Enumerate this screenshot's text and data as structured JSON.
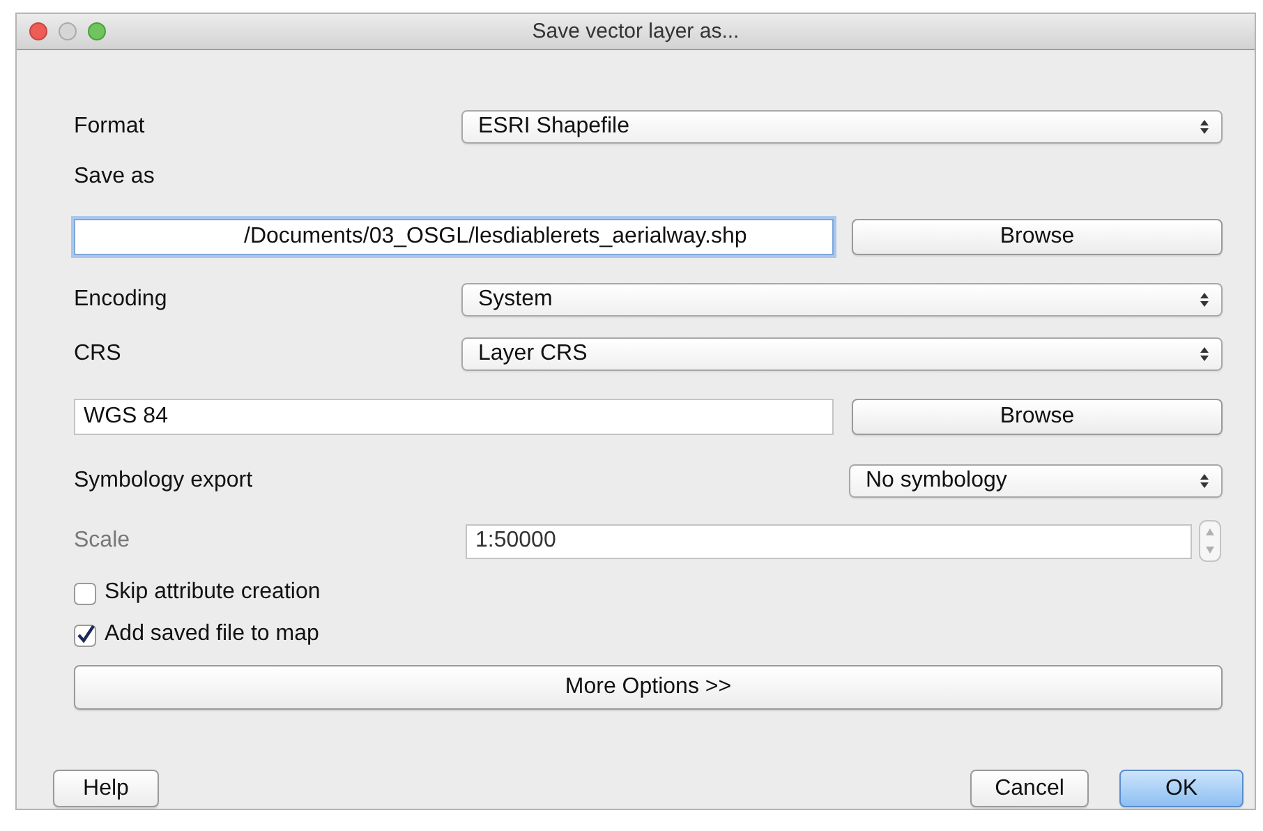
{
  "window": {
    "title": "Save vector layer as..."
  },
  "format": {
    "label": "Format",
    "value": "ESRI Shapefile"
  },
  "save_as": {
    "label": "Save as",
    "value": "/Documents/03_OSGL/lesdiablerets_aerialway.shp",
    "focused": true,
    "browse": "Browse"
  },
  "encoding": {
    "label": "Encoding",
    "value": "System"
  },
  "crs": {
    "label": "CRS",
    "value": "Layer CRS"
  },
  "crs_field": {
    "value": "WGS 84",
    "browse": "Browse"
  },
  "symbology": {
    "label": "Symbology export",
    "value": "No symbology"
  },
  "scale": {
    "label": "Scale",
    "value": "1:50000",
    "disabled": true
  },
  "options": [
    {
      "label": "Skip attribute creation",
      "checked": false
    },
    {
      "label": "Add saved file to map",
      "checked": true
    }
  ],
  "more_options": "More Options >>",
  "left_buttons": [
    {
      "label": "Help",
      "default": false
    }
  ],
  "right_buttons": [
    {
      "label": "Cancel",
      "default": false
    },
    {
      "label": "OK",
      "default": true
    }
  ]
}
